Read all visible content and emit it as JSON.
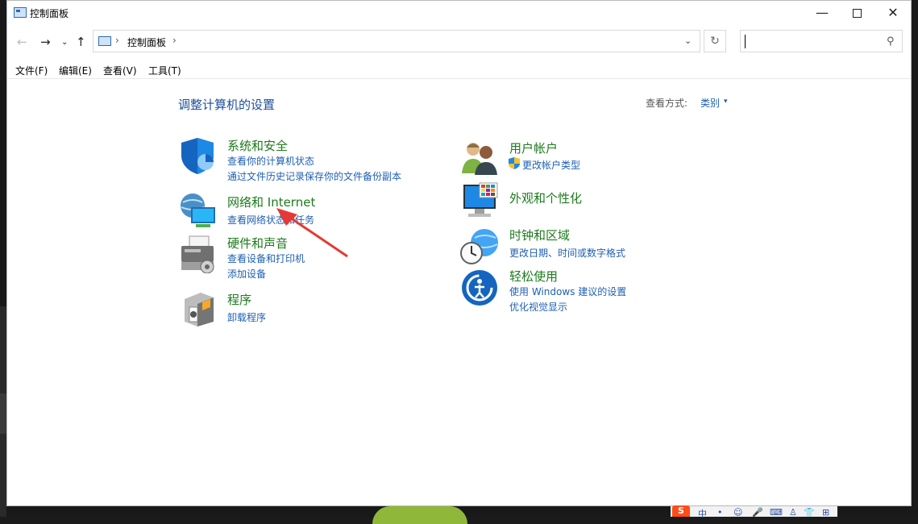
{
  "window": {
    "title": "控制面板",
    "controls": {
      "minimize": "—",
      "close": "✕"
    }
  },
  "nav": {
    "back": "←",
    "forward": "→",
    "recent": "⌄",
    "up": "↑",
    "breadcrumb": "控制面板",
    "separator": "›",
    "dropdown": "⌄",
    "refresh": "↻",
    "search_value": "",
    "search_icon": "⚲"
  },
  "menu": {
    "file": "文件(F)",
    "edit": "编辑(E)",
    "view": "查看(V)",
    "tools": "工具(T)"
  },
  "content": {
    "heading": "调整计算机的设置",
    "view_by_label": "查看方式:",
    "view_by_value": "类别",
    "view_by_arrow": "▾"
  },
  "categories": {
    "system": {
      "title": "系统和安全",
      "links": [
        "查看你的计算机状态",
        "通过文件历史记录保存你的文件备份副本"
      ],
      "icon": "shield-icon"
    },
    "network": {
      "title": "网络和 Internet",
      "links": [
        "查看网络状态和任务"
      ],
      "icon": "network-globe-icon"
    },
    "hardware": {
      "title": "硬件和声音",
      "links": [
        "查看设备和打印机",
        "添加设备"
      ],
      "icon": "printer-icon"
    },
    "programs": {
      "title": "程序",
      "links": [
        "卸载程序"
      ],
      "icon": "programs-box-icon"
    },
    "users": {
      "title": "用户帐户",
      "links": [
        "更改帐户类型"
      ],
      "icon": "users-icon"
    },
    "appearance": {
      "title": "外观和个性化",
      "links": [],
      "icon": "monitor-palette-icon"
    },
    "clock": {
      "title": "时钟和区域",
      "links": [
        "更改日期、时间或数字格式"
      ],
      "icon": "clock-globe-icon"
    },
    "ease": {
      "title": "轻松使用",
      "links": [
        "使用 Windows 建议的设置",
        "优化视觉显示"
      ],
      "icon": "ease-of-access-icon"
    }
  },
  "colors": {
    "category_title": "#1c7a1c",
    "link": "#1e5fb4",
    "heading": "#1e4f9a",
    "annotation": "#e53935"
  },
  "tray": {
    "ime": "S",
    "lang": "中",
    "items": [
      "•",
      "☺",
      "🎤",
      "⌨",
      "♙",
      "👕",
      "⊞"
    ]
  }
}
